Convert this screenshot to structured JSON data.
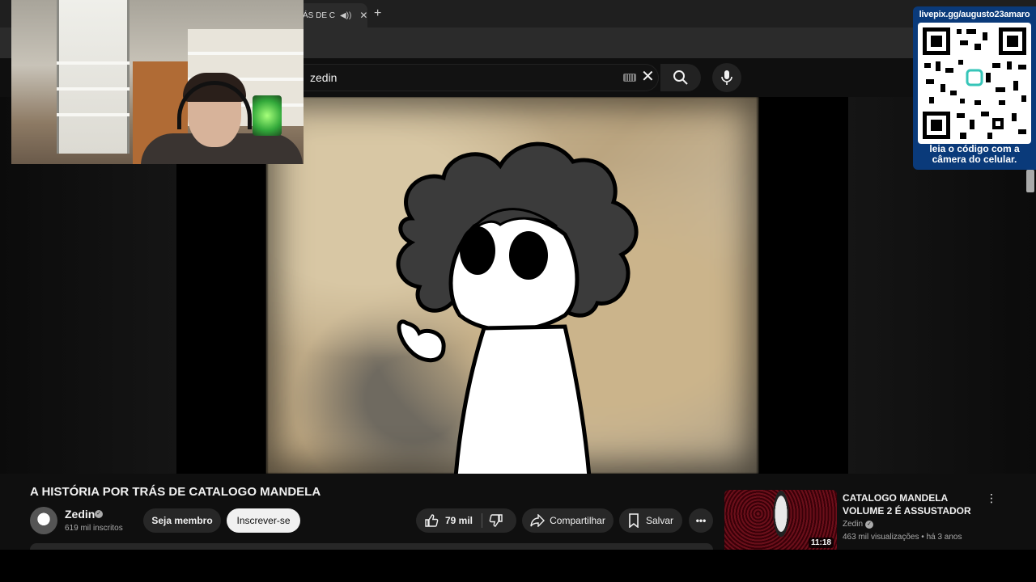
{
  "browser": {
    "tab_title": "ÁS DE C",
    "new_tab_label": "+"
  },
  "search": {
    "query": "zedin"
  },
  "qr_panel": {
    "url": "livepix.gg/augusto23amaro",
    "caption_line1": "leia o código com a",
    "caption_line2": "câmera do celular."
  },
  "video": {
    "title": "A HISTÓRIA POR TRÁS DE CATALOGO MANDELA",
    "channel": "Zedin",
    "subscribers": "619 mil inscritos",
    "member_label": "Seja membro",
    "subscribe_label": "Inscrever-se",
    "likes": "79 mil",
    "share_label": "Compartilhar",
    "save_label": "Salvar"
  },
  "recommended": {
    "title": "CATALOGO MANDELA VOLUME 2 É ASSUSTADOR",
    "channel": "Zedin",
    "views": "463 mil visualizações",
    "age": "há 3 anos",
    "duration": "11:18"
  },
  "colors": {
    "qr_panel": "#0a3a7a",
    "page_bg": "#0f0f0f",
    "subscribe_btn": "#f1f1f1"
  }
}
